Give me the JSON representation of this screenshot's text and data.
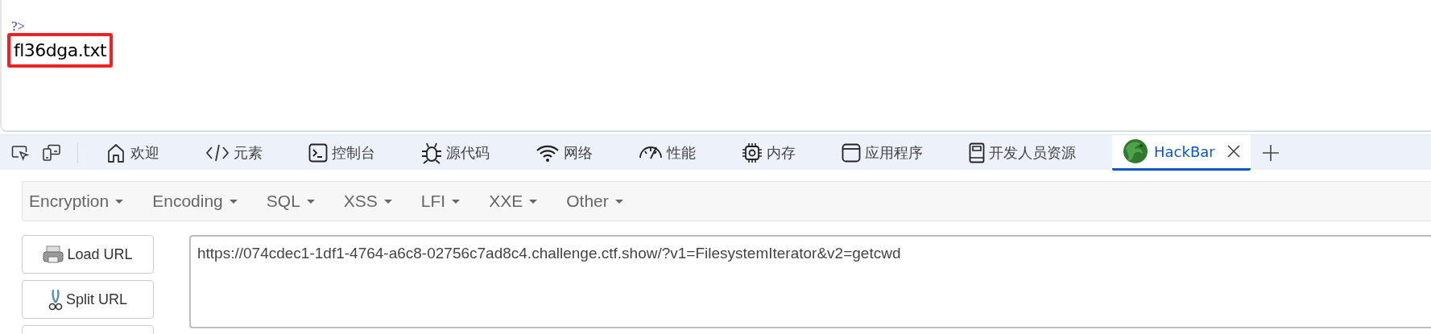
{
  "page": {
    "code_tail": "?>",
    "output": "fl36dga.txt",
    "output_highlighted": true
  },
  "devtools": {
    "tabs": [
      {
        "kind": "home",
        "label": "欢迎",
        "selected": false
      },
      {
        "kind": "code",
        "label": "元素",
        "selected": false
      },
      {
        "kind": "console",
        "label": "控制台",
        "selected": false
      },
      {
        "kind": "bug",
        "label": "源代码",
        "selected": false
      },
      {
        "kind": "wifi",
        "label": "网络",
        "selected": false
      },
      {
        "kind": "gauge",
        "label": "性能",
        "selected": false
      },
      {
        "kind": "chip",
        "label": "内存",
        "selected": false
      },
      {
        "kind": "window",
        "label": "应用程序",
        "selected": false
      },
      {
        "kind": "book",
        "label": "开发人员资源",
        "selected": false
      },
      {
        "kind": "hackbar",
        "label": "HackBar",
        "selected": true,
        "closable": true
      }
    ]
  },
  "hackbar": {
    "menu": [
      "Encryption",
      "Encoding",
      "SQL",
      "XSS",
      "LFI",
      "XXE",
      "Other"
    ],
    "buttons": [
      {
        "kind": "load",
        "label": "Load URL"
      },
      {
        "kind": "split",
        "label": "Split URL"
      }
    ],
    "url": "https://074cdec1-1df1-4764-a6c8-02756c7ad8c4.challenge.ctf.show/?v1=FilesystemIterator&v2=getcwd"
  }
}
